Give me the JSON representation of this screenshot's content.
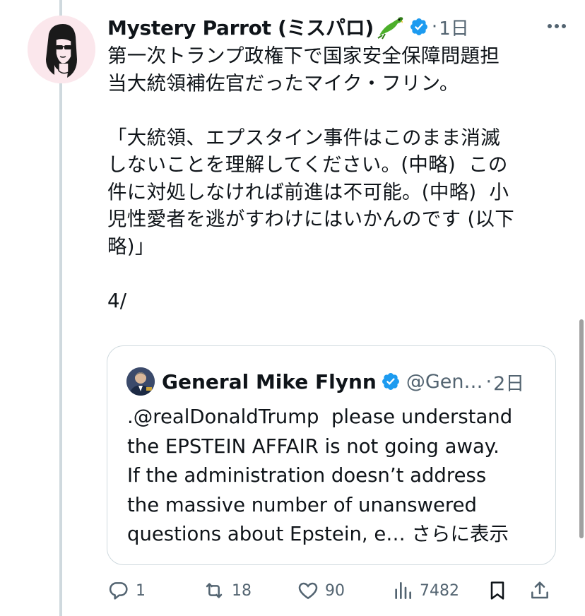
{
  "tweet": {
    "author_name": "Mystery Parrot (ミスパロ)",
    "author_emoji": "parrot-emoji",
    "separator": "·",
    "time": "1日",
    "more_icon": "more-icon",
    "text": "第一次トランプ政権下で国家安全保障問題担\n当大統領補佐官だったマイク・フリン。\n\n「大統領、エプスタイン事件はこのまま消滅\nしないことを理解してください。(中略)  この\n件に対処しなければ前進は不可能。(中略)  小\n児性愛者を逃がすわけにはいかんのです (以下\n略)」\n\n4/"
  },
  "quote": {
    "author_name": "General Mike Flynn",
    "handle": "@Gen…",
    "separator": "·",
    "time": "2日",
    "text": ".@realDonaldTrump  please understand\nthe EPSTEIN AFFAIR is not going away.\nIf the administration doesn’t address\nthe massive number of unanswered\nquestions about Epstein, e… ",
    "show_more": "さらに表示"
  },
  "actions": {
    "replies": "1",
    "reposts": "18",
    "likes": "90",
    "views": "7482"
  },
  "colors": {
    "verified": "#1d9bf0",
    "muted": "#536471",
    "border": "#cfd9de",
    "text": "#0f1419"
  }
}
